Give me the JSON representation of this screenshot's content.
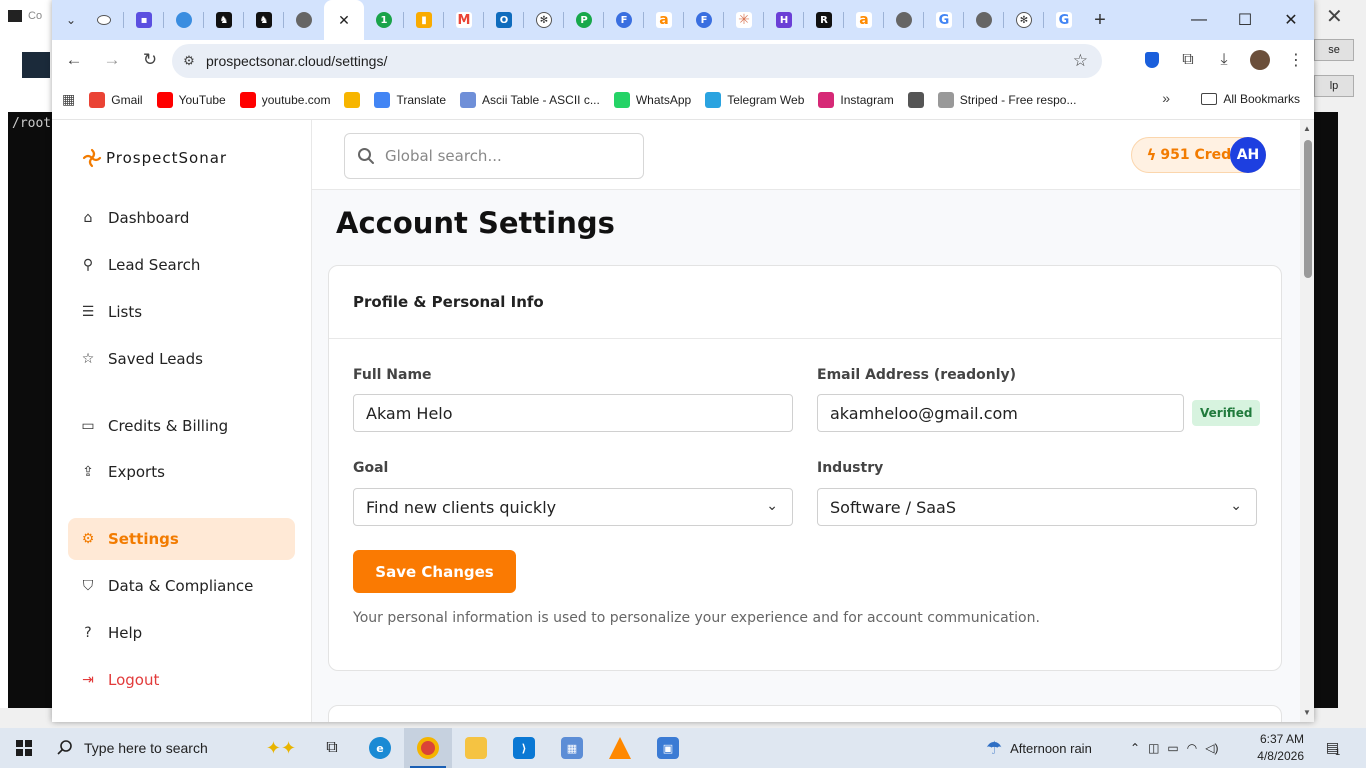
{
  "browser": {
    "url": "prospectsonar.cloud/settings/",
    "bookmarks": [
      {
        "label": "Gmail",
        "icon": "gmail-icon",
        "color": "#ea4335"
      },
      {
        "label": "YouTube",
        "icon": "youtube-icon",
        "color": "#ff0000"
      },
      {
        "label": "youtube.com",
        "icon": "youtube-icon",
        "color": "#ff0000"
      },
      {
        "label": "",
        "icon": "w-logo-icon",
        "color": "#f7b500"
      },
      {
        "label": "Translate",
        "icon": "translate-icon",
        "color": "#4285f4"
      },
      {
        "label": "Ascii Table - ASCII c...",
        "icon": "ascii-icon",
        "color": "#6f8fd8"
      },
      {
        "label": "WhatsApp",
        "icon": "whatsapp-icon",
        "color": "#25d366"
      },
      {
        "label": "Telegram Web",
        "icon": "telegram-icon",
        "color": "#2aa3e0"
      },
      {
        "label": "Instagram",
        "icon": "instagram-icon",
        "color": "#d62976"
      },
      {
        "label": "",
        "icon": "globe-icon",
        "color": "#555555"
      },
      {
        "label": "Striped - Free respo...",
        "icon": "striped-icon",
        "color": "#999999"
      }
    ],
    "all_bookmarks": "All Bookmarks"
  },
  "app": {
    "brand": "ProspectSonar",
    "search_placeholder": "Global search...",
    "credits": "951 Credits",
    "avatar": "AH",
    "nav": [
      {
        "label": "Dashboard",
        "icon": "home-icon"
      },
      {
        "label": "Lead Search",
        "icon": "search-icon"
      },
      {
        "label": "Lists",
        "icon": "list-icon"
      },
      {
        "label": "Saved Leads",
        "icon": "star-icon"
      },
      {
        "label": "Credits & Billing",
        "icon": "credit-card-icon"
      },
      {
        "label": "Exports",
        "icon": "export-icon"
      },
      {
        "label": "Settings",
        "icon": "gear-icon"
      },
      {
        "label": "Data & Compliance",
        "icon": "shield-icon"
      },
      {
        "label": "Help",
        "icon": "help-icon"
      },
      {
        "label": "Logout",
        "icon": "logout-icon"
      }
    ],
    "page_title": "Account Settings",
    "card_title": "Profile & Personal Info",
    "full_name_label": "Full Name",
    "full_name_value": "Akam Helo",
    "email_label": "Email Address (readonly)",
    "email_value": "akamheloo@gmail.com",
    "verified_badge": "Verified",
    "goal_label": "Goal",
    "goal_value": "Find new clients quickly",
    "industry_label": "Industry",
    "industry_value": "Software / SaaS",
    "save_button": "Save Changes",
    "help_text": "Your personal information is used to personalize your experience and for account communication.",
    "accent_color": "#fa7a02"
  },
  "taskbar": {
    "search_placeholder": "Type here to search",
    "weather": "Afternoon rain",
    "time": "6:37 AM",
    "date": "4/8/2026",
    "notifications": "1"
  },
  "background": {
    "terminal_text": "/root",
    "right_btn_1": "se",
    "right_btn_2": "lp"
  }
}
